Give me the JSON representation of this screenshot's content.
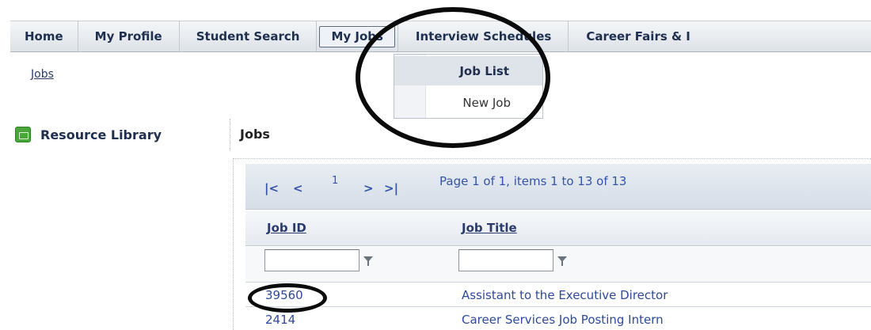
{
  "topnav": {
    "tabs": [
      {
        "label": "Home"
      },
      {
        "label": "My Profile"
      },
      {
        "label": "Student Search"
      },
      {
        "label": "My Jobs"
      },
      {
        "label": "Interview Schedules"
      },
      {
        "label": "Career Fairs & I"
      }
    ],
    "active": "My Jobs"
  },
  "dropdown": {
    "items": [
      {
        "label": "Job List"
      },
      {
        "label": "New Job"
      }
    ]
  },
  "breadcrumb": "Jobs",
  "sidebar": {
    "resource_label": "Resource Library"
  },
  "main": {
    "title": "Jobs",
    "pager": {
      "first": "|<",
      "prev": "<",
      "page": "1",
      "next": ">",
      "last": ">|",
      "info": "Page 1 of 1, items 1 to 13 of 13"
    },
    "columns": [
      "Job ID",
      "Job Title"
    ],
    "filter": {
      "job_id": "",
      "job_title": ""
    },
    "rows": [
      {
        "id": "39560",
        "title": "Assistant to the Executive Director"
      },
      {
        "id": "2414",
        "title": "Career Services Job Posting Intern"
      }
    ]
  }
}
